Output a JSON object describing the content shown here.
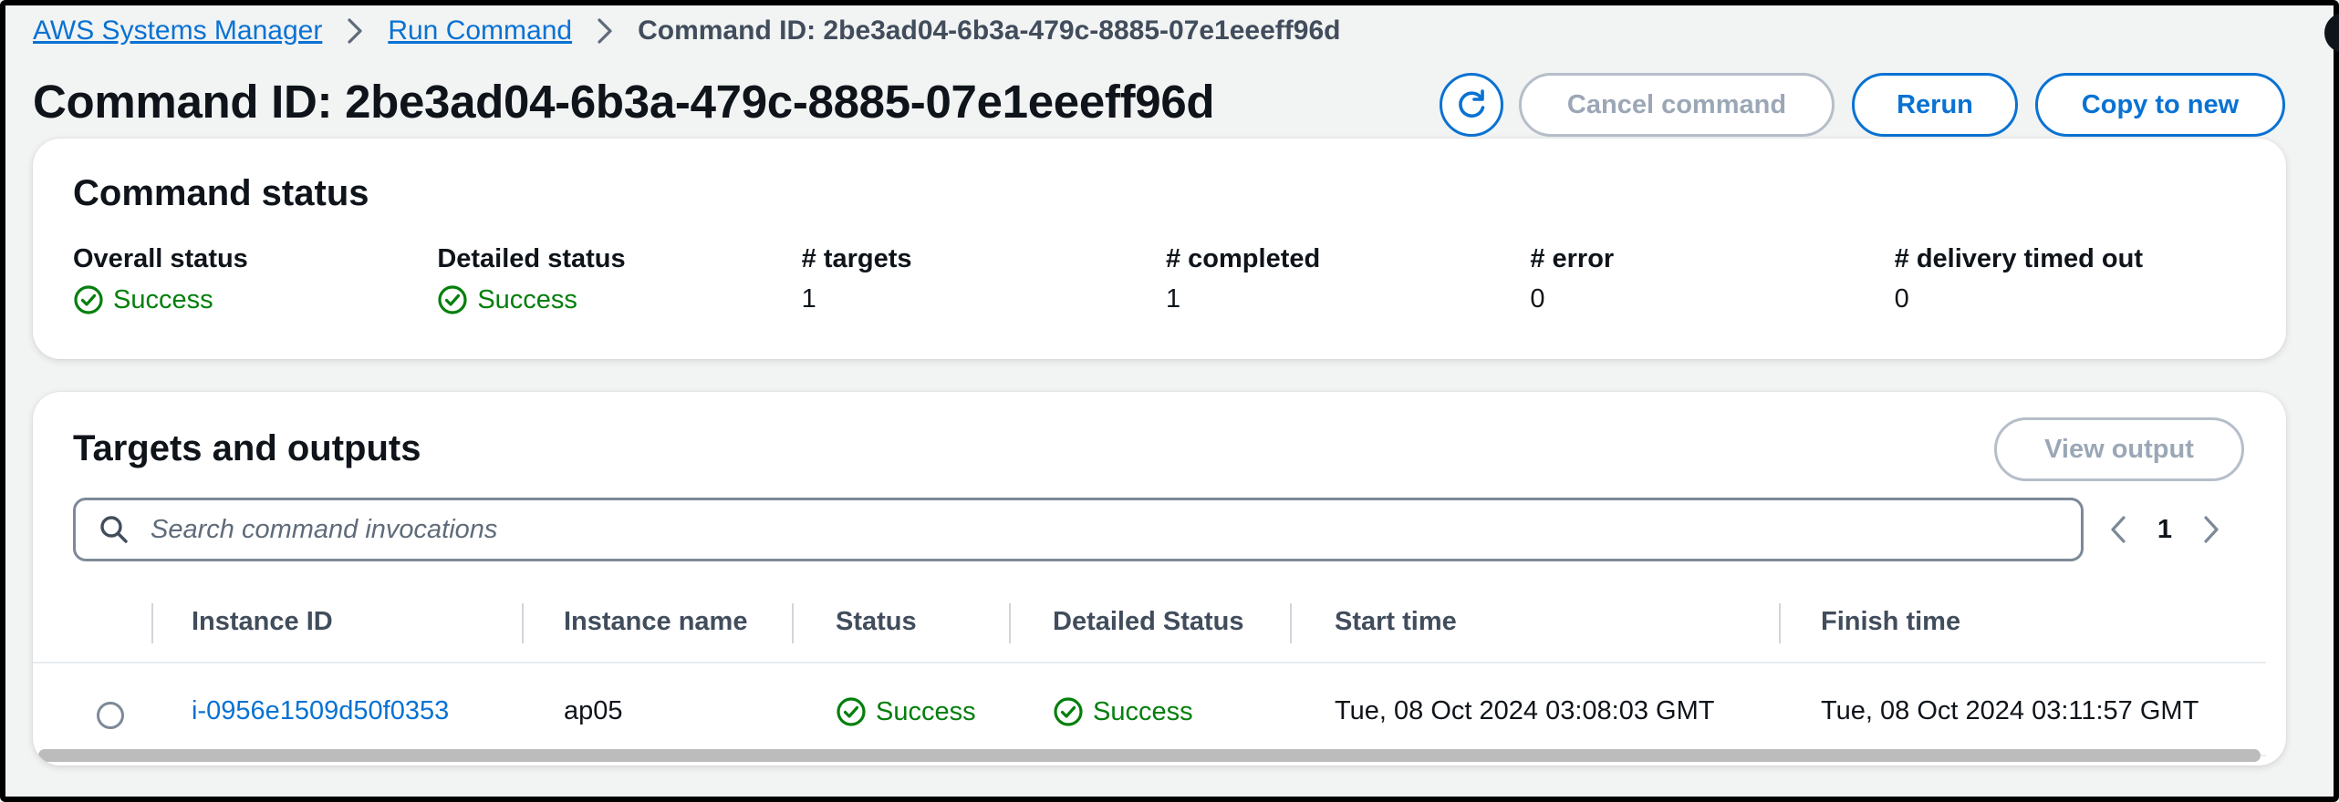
{
  "breadcrumb": {
    "items": [
      {
        "label": "AWS Systems Manager"
      },
      {
        "label": "Run Command"
      }
    ],
    "current": "Command ID: 2be3ad04-6b3a-479c-8885-07e1eeeff96d"
  },
  "header": {
    "title": "Command ID: 2be3ad04-6b3a-479c-8885-07e1eeeff96d",
    "refresh_icon": "refresh-icon",
    "cancel_label": "Cancel command",
    "rerun_label": "Rerun",
    "copy_label": "Copy to new"
  },
  "status_card": {
    "title": "Command status",
    "fields": [
      {
        "label": "Overall status",
        "value": "Success",
        "icon": "success-icon"
      },
      {
        "label": "Detailed status",
        "value": "Success",
        "icon": "success-icon"
      },
      {
        "label": "# targets",
        "value": "1"
      },
      {
        "label": "# completed",
        "value": "1"
      },
      {
        "label": "# error",
        "value": "0"
      },
      {
        "label": "# delivery timed out",
        "value": "0"
      }
    ]
  },
  "targets_card": {
    "title": "Targets and outputs",
    "view_output_label": "View output",
    "search_placeholder": "Search command invocations",
    "search_value": "",
    "page": "1",
    "columns": [
      "Instance ID",
      "Instance name",
      "Status",
      "Detailed Status",
      "Start time",
      "Finish time"
    ],
    "rows": [
      {
        "instance_id": "i-0956e1509d50f0353",
        "instance_name": "ap05",
        "status": "Success",
        "detailed_status": "Success",
        "start_time": "Tue, 08 Oct 2024 03:08:03 GMT",
        "finish_time": "Tue, 08 Oct 2024 03:11:57 GMT"
      }
    ]
  },
  "colors": {
    "link": "#0972d3",
    "success": "#037f0c",
    "disabled": "#9ba7b6",
    "background": "#f2f3f3"
  }
}
